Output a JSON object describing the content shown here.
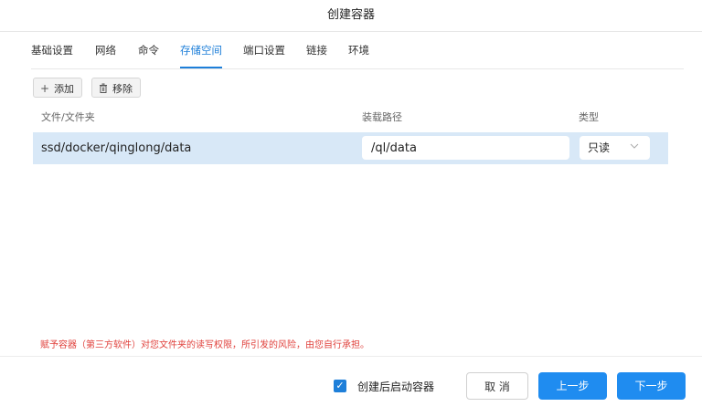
{
  "dialog": {
    "title": "创建容器"
  },
  "tabs": [
    {
      "label": "基础设置",
      "active": false
    },
    {
      "label": "网络",
      "active": false
    },
    {
      "label": "命令",
      "active": false
    },
    {
      "label": "存储空间",
      "active": true
    },
    {
      "label": "端口设置",
      "active": false
    },
    {
      "label": "链接",
      "active": false
    },
    {
      "label": "环境",
      "active": false
    }
  ],
  "toolbar": {
    "add_label": "添加",
    "add_icon": "plus-icon",
    "remove_label": "移除",
    "remove_icon": "trash-icon"
  },
  "table": {
    "columns": [
      "文件/文件夹",
      "装载路径",
      "类型"
    ],
    "rows": [
      {
        "path": "ssd/docker/qinglong/data",
        "mount_path": "/ql/data",
        "type": "只读"
      }
    ]
  },
  "warning": "赋予容器（第三方软件）对您文件夹的读写权限，所引发的风险，由您自行承担。",
  "footer": {
    "autostart_label": "创建后启动容器",
    "autostart_checked": true,
    "cancel_label": "取 消",
    "prev_label": "上一步",
    "next_label": "下一步"
  },
  "colors": {
    "accent": "#1e7fd9",
    "primary_button": "#1f8cf0",
    "row_selected": "#d8e8f7",
    "warning": "#e0413c"
  }
}
